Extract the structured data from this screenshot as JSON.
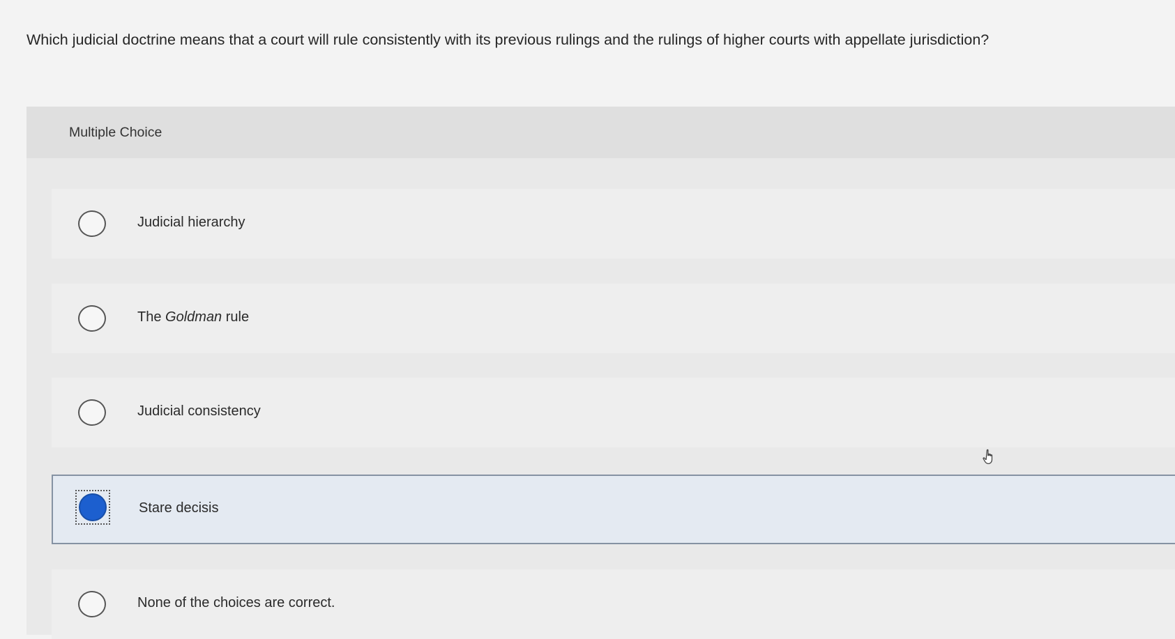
{
  "question": {
    "text": "Which judicial doctrine means that a court will rule consistently with its previous rulings and the rulings of higher courts with appellate jurisdiction?"
  },
  "panel": {
    "title": "Multiple Choice"
  },
  "choices": [
    {
      "prefix": "Judicial hierarchy",
      "italic": "",
      "suffix": "",
      "selected": false
    },
    {
      "prefix": "The ",
      "italic": "Goldman",
      "suffix": " rule",
      "selected": false
    },
    {
      "prefix": "Judicial consistency",
      "italic": "",
      "suffix": "",
      "selected": false
    },
    {
      "prefix": "Stare decisis",
      "italic": "",
      "suffix": "",
      "selected": true
    },
    {
      "prefix": "None of the choices are correct.",
      "italic": "",
      "suffix": "",
      "selected": false
    }
  ],
  "colors": {
    "selected_fill": "#1c5fcf",
    "selected_background": "#e4eaf2"
  },
  "icons": {
    "cursor": "hand-pointer-icon"
  }
}
